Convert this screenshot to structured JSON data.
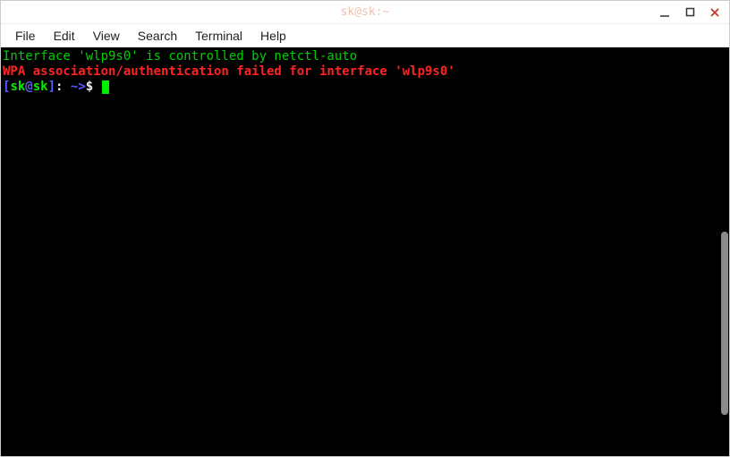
{
  "titlebar": {
    "title": "sk@sk:~"
  },
  "menubar": {
    "items": [
      "File",
      "Edit",
      "View",
      "Search",
      "Terminal",
      "Help"
    ]
  },
  "terminal": {
    "line1": "Interface 'wlp9s0' is controlled by netctl-auto",
    "line2": "WPA association/authentication failed for interface 'wlp9s0'",
    "prompt": {
      "lb": "[",
      "user": "sk",
      "at": "@",
      "host": "sk",
      "rb": "]",
      "colon": ": ",
      "path": "~>",
      "dollar": "$ "
    }
  }
}
